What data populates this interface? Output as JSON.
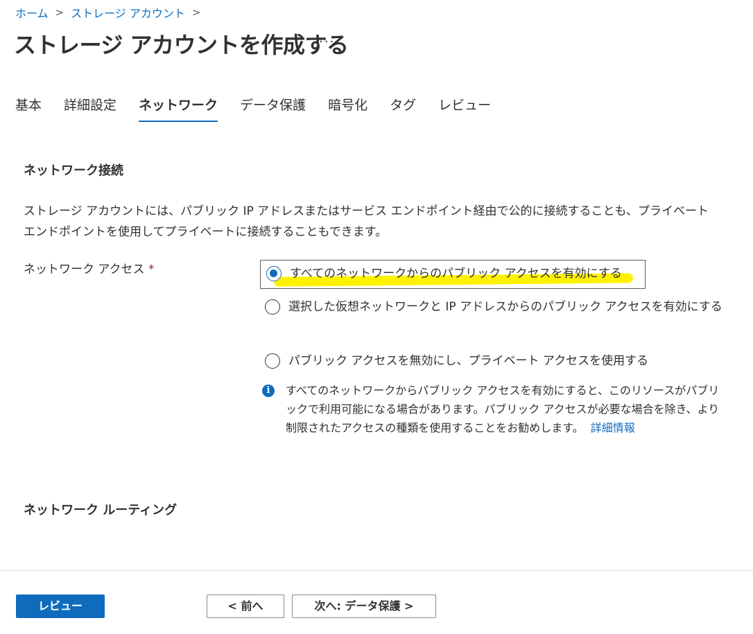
{
  "breadcrumb": {
    "items": [
      "ホーム",
      "ストレージ アカウント"
    ],
    "sep": ">"
  },
  "page": {
    "title": "ストレージ アカウントを作成する",
    "more": "···"
  },
  "tabs": [
    {
      "label": "基本",
      "active": false
    },
    {
      "label": "詳細設定",
      "active": false
    },
    {
      "label": "ネットワーク",
      "active": true
    },
    {
      "label": "データ保護",
      "active": false
    },
    {
      "label": "暗号化",
      "active": false
    },
    {
      "label": "タグ",
      "active": false
    },
    {
      "label": "レビュー",
      "active": false
    }
  ],
  "network_connection": {
    "title": "ネットワーク接続",
    "description": "ストレージ アカウントには、パブリック IP アドレスまたはサービス エンドポイント経由で公的に接続することも、プライベート エンドポイントを使用してプライベートに接続することもできます。"
  },
  "network_access": {
    "label": "ネットワーク アクセス",
    "required_mark": "*",
    "options": [
      {
        "label": "すべてのネットワークからのパブリック アクセスを有効にする",
        "checked": true
      },
      {
        "label": "選択した仮想ネットワークと IP アドレスからのパブリック アクセスを有効にする",
        "checked": false
      },
      {
        "label": "パブリック アクセスを無効にし、プライベート アクセスを使用する",
        "checked": false
      }
    ],
    "info_icon": "info-icon",
    "info_text": "すべてのネットワークからパブリック アクセスを有効にすると、このリソースがパブリックで利用可能になる場合があります。パブリック アクセスが必要な場合を除き、より制限されたアクセスの種類を使用することをお勧めします。",
    "info_link": "詳細情報"
  },
  "network_routing": {
    "title": "ネットワーク ルーティング"
  },
  "footer": {
    "review_label": "レビュー",
    "prev_label": "< 前へ",
    "next_label": "次へ: データ保護 >"
  },
  "colors": {
    "accent": "#0f6cbd",
    "highlight": "#fff200",
    "required": "#a4262c"
  }
}
